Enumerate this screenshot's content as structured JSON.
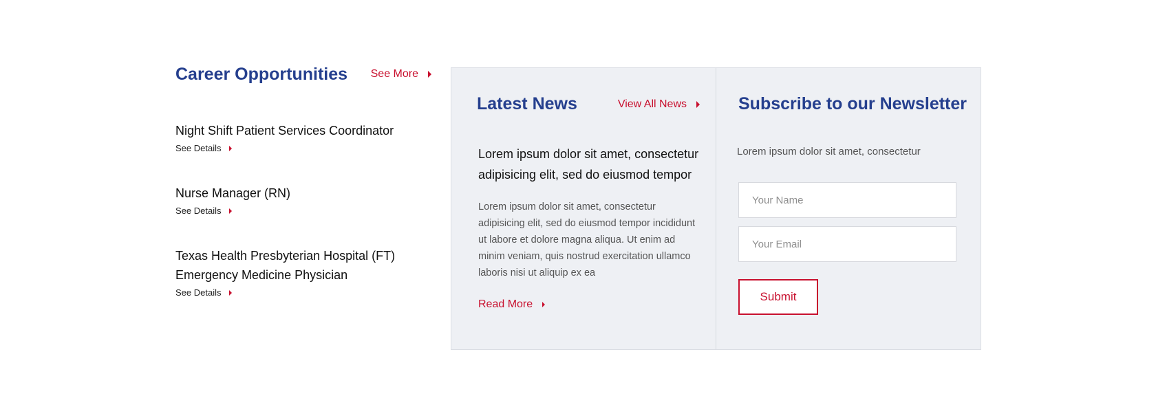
{
  "careers": {
    "title": "Career Opportunities",
    "see_more": "See More",
    "jobs": [
      {
        "title": "Night Shift Patient Services Coordinator",
        "details": "See Details"
      },
      {
        "title": "Nurse Manager (RN)",
        "details": "See Details"
      },
      {
        "title": "Texas Health Presbyterian Hospital (FT) Emergency Medicine Physician",
        "details": "See Details"
      }
    ]
  },
  "news": {
    "title": "Latest News",
    "view_all": "View All News",
    "headline": "Lorem ipsum dolor sit amet, consectetur adipisicing elit, sed do eiusmod tempor",
    "body": "Lorem ipsum dolor sit amet, consectetur adipisicing elit, sed do eiusmod tempor incididunt ut labore et dolore magna aliqua. Ut enim ad minim veniam, quis nostrud exercitation ullamco laboris nisi ut aliquip ex ea",
    "read_more": "Read More"
  },
  "newsletter": {
    "title": "Subscribe to our Newsletter",
    "description": "Lorem ipsum dolor sit amet, consectetur",
    "name_placeholder": "Your Name",
    "email_placeholder": "Your Email",
    "submit": "Submit"
  },
  "colors": {
    "heading_blue": "#253f8e",
    "accent_red": "#c8102e",
    "panel_bg": "#eef0f4"
  }
}
